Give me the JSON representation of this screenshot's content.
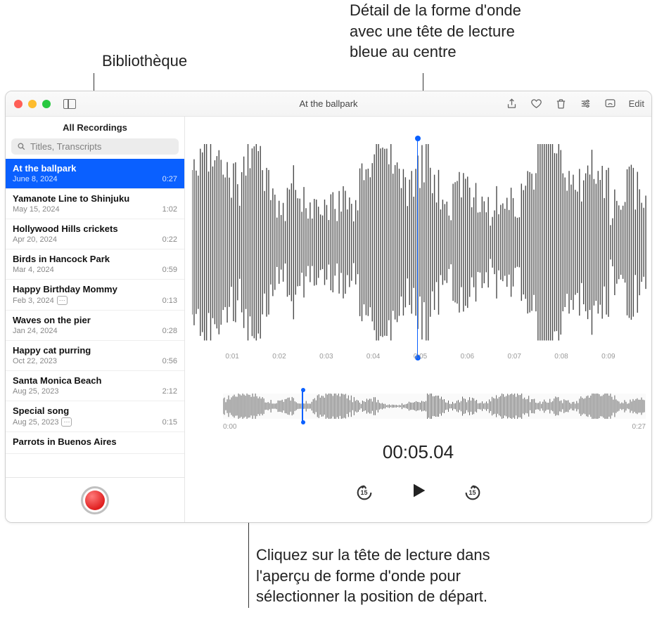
{
  "callouts": {
    "library": "Bibliothèque",
    "waveform_detail_l1": "Détail de la forme d'onde",
    "waveform_detail_l2": "avec une tête de lecture",
    "waveform_detail_l3": "bleue au centre",
    "overview_l1": "Cliquez sur la tête de lecture dans",
    "overview_l2": "l'aperçu de forme d'onde pour",
    "overview_l3": "sélectionner la position de départ."
  },
  "window_title": "At the ballpark",
  "edit_label": "Edit",
  "sidebar": {
    "header": "All Recordings",
    "search_placeholder": "Titles, Transcripts"
  },
  "recordings": [
    {
      "title": "At the ballpark",
      "date": "June 8, 2024",
      "duration": "0:27",
      "selected": true,
      "badge": false
    },
    {
      "title": "Yamanote Line to Shinjuku",
      "date": "May 15, 2024",
      "duration": "1:02",
      "selected": false,
      "badge": false
    },
    {
      "title": "Hollywood Hills crickets",
      "date": "Apr 20, 2024",
      "duration": "0:22",
      "selected": false,
      "badge": false
    },
    {
      "title": "Birds in Hancock Park",
      "date": "Mar 4, 2024",
      "duration": "0:59",
      "selected": false,
      "badge": false
    },
    {
      "title": "Happy Birthday Mommy",
      "date": "Feb 3, 2024",
      "duration": "0:13",
      "selected": false,
      "badge": true
    },
    {
      "title": "Waves on the pier",
      "date": "Jan 24, 2024",
      "duration": "0:28",
      "selected": false,
      "badge": false
    },
    {
      "title": "Happy cat purring",
      "date": "Oct 22, 2023",
      "duration": "0:56",
      "selected": false,
      "badge": false
    },
    {
      "title": "Santa Monica Beach",
      "date": "Aug 25, 2023",
      "duration": "2:12",
      "selected": false,
      "badge": false
    },
    {
      "title": "Special song",
      "date": "Aug 25, 2023",
      "duration": "0:15",
      "selected": false,
      "badge": true
    },
    {
      "title": "Parrots in Buenos Aires",
      "date": "",
      "duration": "",
      "selected": false,
      "badge": false
    }
  ],
  "time_axis": [
    "",
    "0:01",
    "0:02",
    "0:03",
    "0:04",
    "0:05",
    "0:06",
    "0:07",
    "0:08",
    "0:09",
    ""
  ],
  "overview_start": "0:00",
  "overview_end": "0:27",
  "timecode": "00:05.04",
  "skip_amount": "15",
  "colors": {
    "accent": "#0a60ff",
    "close": "#ff5f57",
    "min": "#febc2e",
    "max": "#28c840"
  }
}
